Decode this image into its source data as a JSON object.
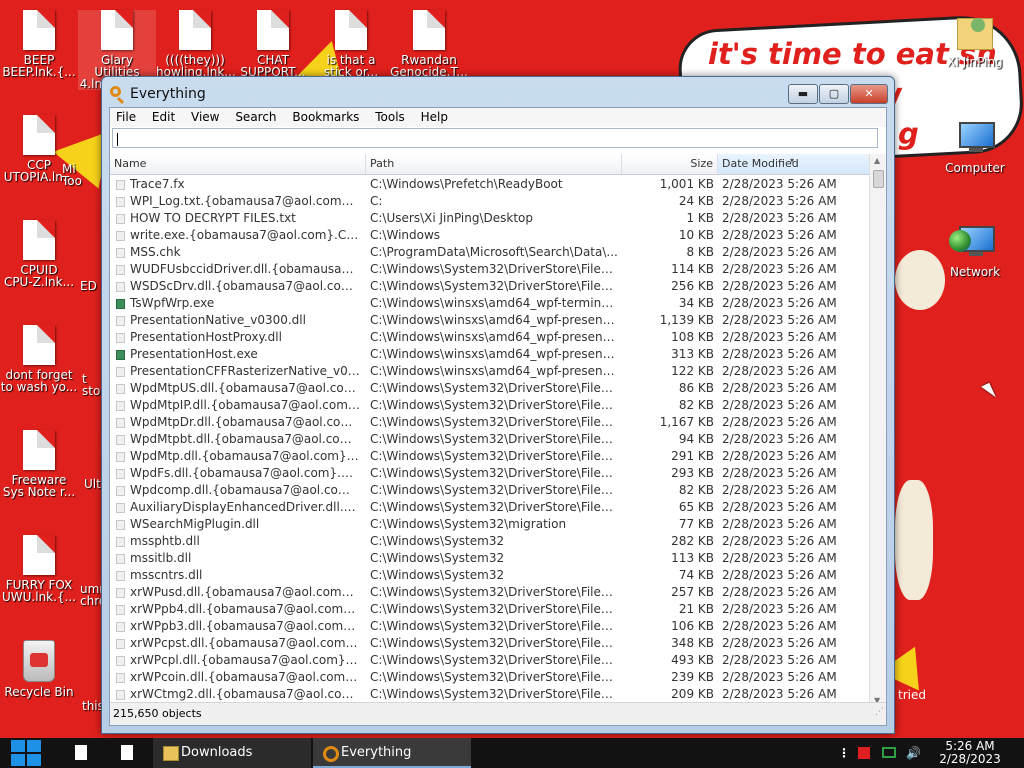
{
  "wallpaper": {
    "banner_lines": [
      "it's time to eat sh",
      "chew",
      "g"
    ],
    "bottom_right_text": "tried"
  },
  "desktop_icons_left": [
    {
      "label": "BEEP\nBEEP.lnk.{..."
    },
    {
      "label": "Glary Utilities\n4.lnk.{obe..."
    },
    {
      "label": "((((they)))\nhowling.lnk..."
    },
    {
      "label": "CHAT\nSUPPORT..."
    },
    {
      "label": "is that a\nstick or..."
    },
    {
      "label": "Rwandan\nGenocide.T..."
    },
    {
      "label": "CCP\nUTOPIA.ln..."
    },
    {
      "label": "CPUID\nCPU-Z.lnk..."
    },
    {
      "label": "dont forget\nto wash yo..."
    },
    {
      "label": "Freeware\nSys Note r..."
    },
    {
      "label": "FURRY FOX\nUWU.lnk.{..."
    },
    {
      "label": "Recycle Bin"
    }
  ],
  "desktop_icons_partial": [
    "Mi\nToo",
    "ED",
    "t\nsto",
    "Ult",
    "umr\nchro",
    "this"
  ],
  "desktop_icons_right": [
    {
      "label": "Xi JinPing"
    },
    {
      "label": "Computer"
    },
    {
      "label": "Network"
    }
  ],
  "window": {
    "title": "Everything",
    "buttons": {
      "minimize": "▬",
      "maximize": "▢",
      "close": "✕"
    },
    "menu": [
      "File",
      "Edit",
      "View",
      "Search",
      "Bookmarks",
      "Tools",
      "Help"
    ],
    "search_value": "",
    "columns": {
      "name": "Name",
      "path": "Path",
      "size": "Size",
      "date": "Date Modified"
    },
    "rows": [
      {
        "name": "Trace7.fx",
        "path": "C:\\Windows\\Prefetch\\ReadyBoot",
        "size": "1,001 KB",
        "date": "2/28/2023 5:26 AM",
        "exe": false
      },
      {
        "name": "WPI_Log.txt.{obamausa7@aol.com}.Cr...",
        "path": "C:",
        "size": "24 KB",
        "date": "2/28/2023 5:26 AM",
        "exe": false
      },
      {
        "name": "HOW TO DECRYPT FILES.txt",
        "path": "C:\\Users\\Xi JinPing\\Desktop",
        "size": "1 KB",
        "date": "2/28/2023 5:26 AM",
        "exe": false
      },
      {
        "name": "write.exe.{obamausa7@aol.com}.CrySiS",
        "path": "C:\\Windows",
        "size": "10 KB",
        "date": "2/28/2023 5:26 AM",
        "exe": false
      },
      {
        "name": "MSS.chk",
        "path": "C:\\ProgramData\\Microsoft\\Search\\Data\\...",
        "size": "8 KB",
        "date": "2/28/2023 5:26 AM",
        "exe": false
      },
      {
        "name": "WUDFUsbccidDriver.dll.{obamausa7@a...",
        "path": "C:\\Windows\\System32\\DriverStore\\FileRe...",
        "size": "114 KB",
        "date": "2/28/2023 5:26 AM",
        "exe": false
      },
      {
        "name": "WSDScDrv.dll.{obamausa7@aol.com}....",
        "path": "C:\\Windows\\System32\\DriverStore\\FileRe...",
        "size": "256 KB",
        "date": "2/28/2023 5:26 AM",
        "exe": false
      },
      {
        "name": "TsWpfWrp.exe",
        "path": "C:\\Windows\\winsxs\\amd64_wpf-terminalse...",
        "size": "34 KB",
        "date": "2/28/2023 5:26 AM",
        "exe": true
      },
      {
        "name": "PresentationNative_v0300.dll",
        "path": "C:\\Windows\\winsxs\\amd64_wpf-presentati...",
        "size": "1,139 KB",
        "date": "2/28/2023 5:26 AM",
        "exe": false
      },
      {
        "name": "PresentationHostProxy.dll",
        "path": "C:\\Windows\\winsxs\\amd64_wpf-presentati...",
        "size": "108 KB",
        "date": "2/28/2023 5:26 AM",
        "exe": false
      },
      {
        "name": "PresentationHost.exe",
        "path": "C:\\Windows\\winsxs\\amd64_wpf-presentati...",
        "size": "313 KB",
        "date": "2/28/2023 5:26 AM",
        "exe": true
      },
      {
        "name": "PresentationCFFRasterizerNative_v030...",
        "path": "C:\\Windows\\winsxs\\amd64_wpf-presentati...",
        "size": "122 KB",
        "date": "2/28/2023 5:26 AM",
        "exe": false
      },
      {
        "name": "WpdMtpUS.dll.{obamausa7@aol.com}....",
        "path": "C:\\Windows\\System32\\DriverStore\\FileRe...",
        "size": "86 KB",
        "date": "2/28/2023 5:26 AM",
        "exe": false
      },
      {
        "name": "WpdMtpIP.dll.{obamausa7@aol.com}.Cr...",
        "path": "C:\\Windows\\System32\\DriverStore\\FileRe...",
        "size": "82 KB",
        "date": "2/28/2023 5:26 AM",
        "exe": false
      },
      {
        "name": "WpdMtpDr.dll.{obamausa7@aol.com}.C...",
        "path": "C:\\Windows\\System32\\DriverStore\\FileRe...",
        "size": "1,167 KB",
        "date": "2/28/2023 5:26 AM",
        "exe": false
      },
      {
        "name": "WpdMtpbt.dll.{obamausa7@aol.com}.Cr...",
        "path": "C:\\Windows\\System32\\DriverStore\\FileRe...",
        "size": "94 KB",
        "date": "2/28/2023 5:26 AM",
        "exe": false
      },
      {
        "name": "WpdMtp.dll.{obamausa7@aol.com}.Cry...",
        "path": "C:\\Windows\\System32\\DriverStore\\FileRe...",
        "size": "291 KB",
        "date": "2/28/2023 5:26 AM",
        "exe": false
      },
      {
        "name": "WpdFs.dll.{obamausa7@aol.com}.CrySiS",
        "path": "C:\\Windows\\System32\\DriverStore\\FileRe...",
        "size": "293 KB",
        "date": "2/28/2023 5:26 AM",
        "exe": false
      },
      {
        "name": "Wpdcomp.dll.{obamausa7@aol.com}.Cr...",
        "path": "C:\\Windows\\System32\\DriverStore\\FileRe...",
        "size": "82 KB",
        "date": "2/28/2023 5:26 AM",
        "exe": false
      },
      {
        "name": "AuxiliaryDisplayEnhancedDriver.dll.{oba...",
        "path": "C:\\Windows\\System32\\DriverStore\\FileRe...",
        "size": "65 KB",
        "date": "2/28/2023 5:26 AM",
        "exe": false
      },
      {
        "name": "WSearchMigPlugin.dll",
        "path": "C:\\Windows\\System32\\migration",
        "size": "77 KB",
        "date": "2/28/2023 5:26 AM",
        "exe": false
      },
      {
        "name": "mssphtb.dll",
        "path": "C:\\Windows\\System32",
        "size": "282 KB",
        "date": "2/28/2023 5:26 AM",
        "exe": false
      },
      {
        "name": "mssitlb.dll",
        "path": "C:\\Windows\\System32",
        "size": "113 KB",
        "date": "2/28/2023 5:26 AM",
        "exe": false
      },
      {
        "name": "msscntrs.dll",
        "path": "C:\\Windows\\System32",
        "size": "74 KB",
        "date": "2/28/2023 5:26 AM",
        "exe": false
      },
      {
        "name": "xrWPusd.dll.{obamausa7@aol.com}.Cry...",
        "path": "C:\\Windows\\System32\\DriverStore\\FileRe...",
        "size": "257 KB",
        "date": "2/28/2023 5:26 AM",
        "exe": false
      },
      {
        "name": "xrWPpb4.dll.{obamausa7@aol.com}.Cry...",
        "path": "C:\\Windows\\System32\\DriverStore\\FileRe...",
        "size": "21 KB",
        "date": "2/28/2023 5:26 AM",
        "exe": false
      },
      {
        "name": "xrWPpb3.dll.{obamausa7@aol.com}.Cry...",
        "path": "C:\\Windows\\System32\\DriverStore\\FileRe...",
        "size": "106 KB",
        "date": "2/28/2023 5:26 AM",
        "exe": false
      },
      {
        "name": "xrWPcpst.dll.{obamausa7@aol.com}.Cr...",
        "path": "C:\\Windows\\System32\\DriverStore\\FileRe...",
        "size": "348 KB",
        "date": "2/28/2023 5:26 AM",
        "exe": false
      },
      {
        "name": "xrWPcpl.dll.{obamausa7@aol.com}.CrySiS",
        "path": "C:\\Windows\\System32\\DriverStore\\FileRe...",
        "size": "493 KB",
        "date": "2/28/2023 5:26 AM",
        "exe": false
      },
      {
        "name": "xrWPcoin.dll.{obamausa7@aol.com}.Cry...",
        "path": "C:\\Windows\\System32\\DriverStore\\FileRe...",
        "size": "239 KB",
        "date": "2/28/2023 5:26 AM",
        "exe": false
      },
      {
        "name": "xrWCtmg2.dll.{obamausa7@aol.com}.Cr...",
        "path": "C:\\Windows\\System32\\DriverStore\\FileRe...",
        "size": "209 KB",
        "date": "2/28/2023 5:26 AM",
        "exe": false
      }
    ],
    "status": "215,650 objects"
  },
  "taskbar": {
    "apps": [
      {
        "label": "Downloads",
        "icon": "folder-icon"
      },
      {
        "label": "Everything",
        "icon": "everything-search-icon"
      }
    ],
    "clock_time": "5:26 AM",
    "clock_date": "2/28/2023"
  }
}
